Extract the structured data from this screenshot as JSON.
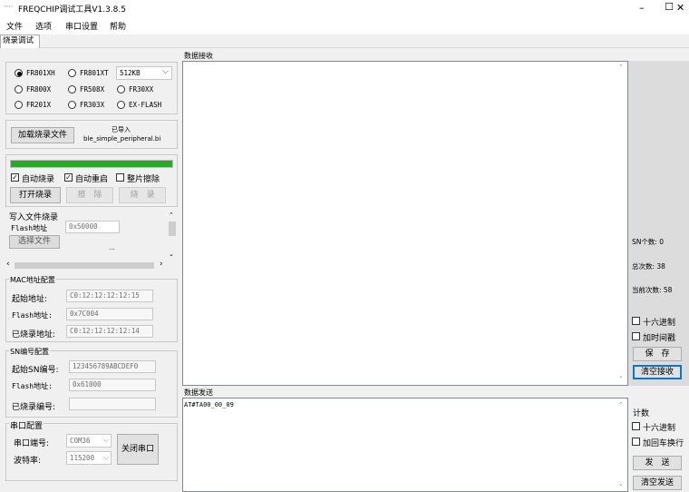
{
  "window": {
    "title": "FREQCHIP调试工具V1.3.8.5",
    "min": "–",
    "max": "☐",
    "close": "✕"
  },
  "menu": {
    "file": "文件",
    "options": "选项",
    "serial_settings": "串口设置",
    "help": "帮助"
  },
  "tabs": {
    "burn_debug": "烧录调试"
  },
  "chips": {
    "fr801xh": "FR801XH",
    "fr801xt": "FR801XT",
    "size": "512KB",
    "fr800x": "FR800X",
    "fr508x": "FR508X",
    "fr30xx": "FR30XX",
    "fr201x": "FR201X",
    "fr303x": "FR303X",
    "exflash": "EX-FLASH"
  },
  "load": {
    "button": "加载烧录文件",
    "status": "已导入",
    "filename": "ble_simple_peripheral.bi"
  },
  "progress": {
    "fraction": 1.0,
    "color": "#1eb11e"
  },
  "opts": {
    "auto_burn": "自动烧录",
    "auto_restart": "自动重启",
    "full_erase": "整片擦除"
  },
  "actions": {
    "open_burn": "打开烧录",
    "erase": "擦　除",
    "burn": "烧　录"
  },
  "write_file": {
    "title": "写入文件烧录",
    "flash_label": "Flash地址",
    "flash_value": "0x50000",
    "select": "选择文件",
    "ellipsis": "..."
  },
  "mac": {
    "title": "MAC地址配置",
    "start_label": "起始地址:",
    "start_value": "C0:12:12:12:12:15",
    "flash_label": "Flash地址:",
    "flash_value": "0x7C004",
    "burned_label": "已烧录地址:",
    "burned_value": "C0:12:12:12:12:14"
  },
  "sn": {
    "title": "SN编号配置",
    "start_label": "起始SN编号:",
    "start_value": "123456789ABCDEF0",
    "flash_label": "Flash地址:",
    "flash_value": "0x61000",
    "burned_label": "已烧录编号:",
    "burned_value": ""
  },
  "serial": {
    "title": "串口配置",
    "port_label": "串口端号:",
    "port_value": "COM36",
    "baud_label": "波特率:",
    "baud_value": "115200",
    "close_button": "关闭串口"
  },
  "receive": {
    "title": "数据接收",
    "sn_count": "SN个数: 0",
    "total_count": "总次数: 38",
    "current_count": "当前次数: 58",
    "hex": "十六进制",
    "timestamp": "加时间戳",
    "save": "保　存",
    "clear": "清空接收"
  },
  "send": {
    "title": "数据发送",
    "content": "AT#TA00_00_09",
    "count_label": "计数",
    "hex": "十六进制",
    "crlf": "加回车换行",
    "send": "发　送",
    "clear": "清空发送"
  }
}
